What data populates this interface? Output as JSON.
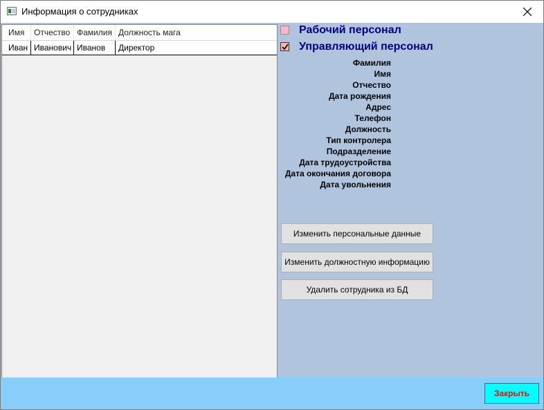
{
  "window": {
    "title": "Информация о сотрудниках"
  },
  "grid": {
    "columns": [
      "Имя",
      "Отчество",
      "Фамилия",
      "Должность мага"
    ],
    "rows": [
      [
        "Иван",
        "Иванович",
        "Иванов",
        "Директор"
      ]
    ]
  },
  "filters": {
    "working_staff": {
      "label": "Рабочий персонал",
      "checked": false
    },
    "management_staff": {
      "label": "Управляющий персонал",
      "checked": true
    }
  },
  "fields": [
    "Фамилия",
    "Имя",
    "Отчество",
    "Дата рождения",
    "Адрес",
    "Телефон",
    "Должность",
    "Тип контролера",
    "Подразделение",
    "Дата трудоустройства",
    "Дата окончания договора",
    "Дата увольнения"
  ],
  "actions": {
    "edit_personal": "Изменить персональные данные",
    "edit_position": "Изменить должностную информацию",
    "delete_employee": "Удалить сотрудника из БД"
  },
  "footer": {
    "close_label": "Закрыть"
  },
  "colors": {
    "content_bg": "#b0c4de",
    "footer_bg": "#87cefa",
    "label_text": "#000080",
    "close_button_bg": "#00ffff",
    "close_button_text": "#ff0000"
  },
  "icons": [
    "app-icon",
    "close-icon",
    "checkmark-icon"
  ]
}
